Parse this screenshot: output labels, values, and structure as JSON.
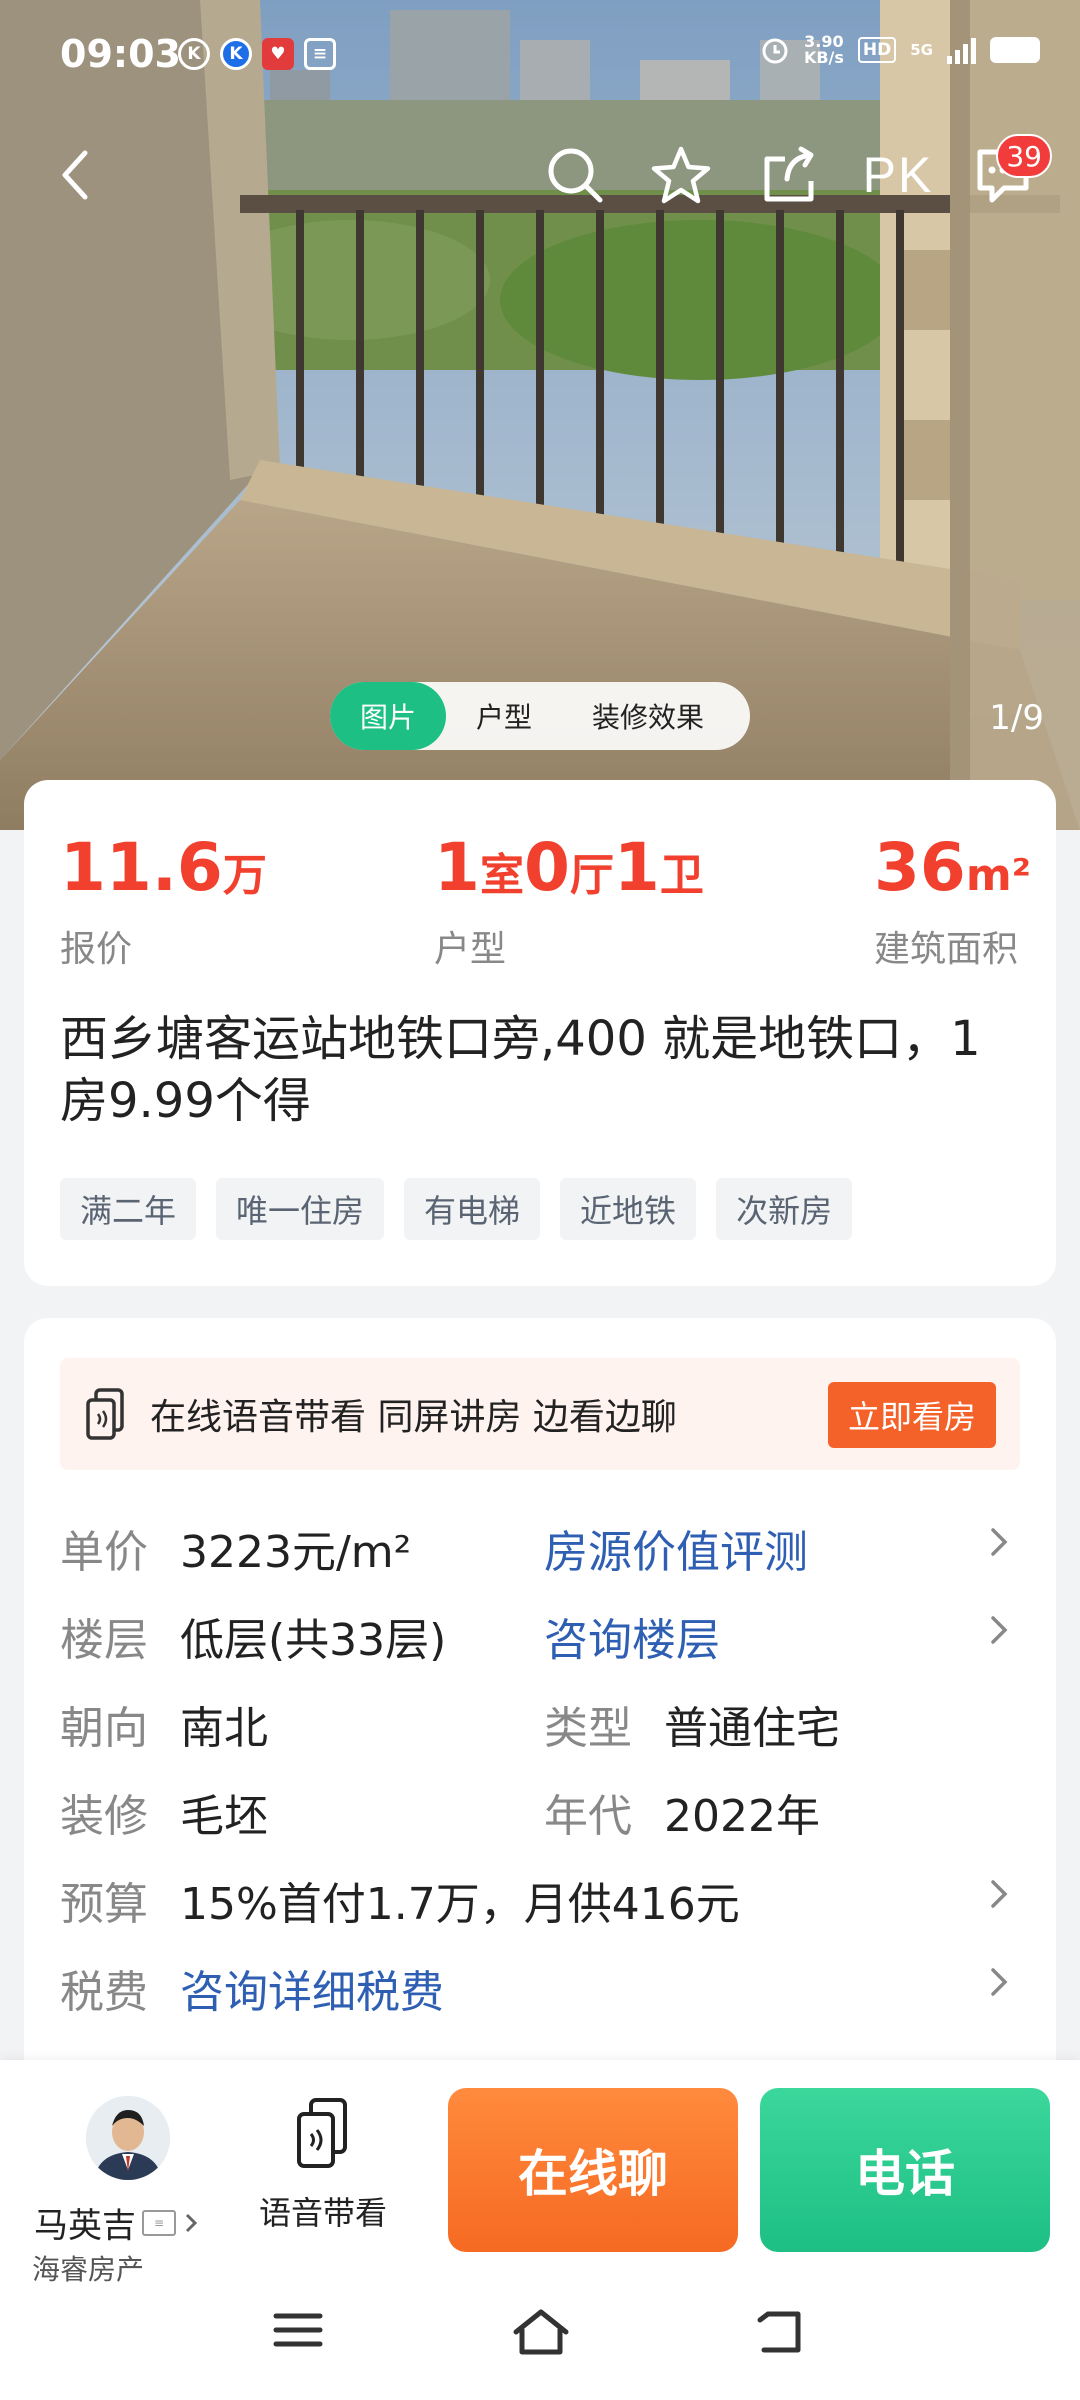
{
  "status_bar": {
    "time": "09:03",
    "net_speed_value": "3.90",
    "net_speed_unit": "KB/s",
    "hd_label": "HD",
    "network_label": "5G",
    "notification_icons": [
      "k-icon",
      "k-blue-icon",
      "heart-app-icon",
      "card-app-icon"
    ]
  },
  "top_nav": {
    "pk_label": "PK",
    "message_badge": "39"
  },
  "media": {
    "tabs": [
      "图片",
      "户型",
      "装修效果"
    ],
    "active_tab": 0,
    "counter": "1/9"
  },
  "summary": {
    "price_value": "11.6",
    "price_unit": "万",
    "price_label": "报价",
    "layout_n1": "1",
    "layout_u1": "室",
    "layout_n2": "0",
    "layout_u2": "厅",
    "layout_n3": "1",
    "layout_u3": "卫",
    "layout_label": "户型",
    "area_value": "36",
    "area_unit": "m²",
    "area_label": "建筑面积",
    "title": "西乡塘客运站地铁口旁,400 就是地铁口，1房9.99个得",
    "tags": [
      "满二年",
      "唯一住房",
      "有电梯",
      "近地铁",
      "次新房"
    ]
  },
  "banner": {
    "text": "在线语音带看  同屏讲房 边看边聊",
    "button": "立即看房"
  },
  "details": {
    "unit_price_key": "单价",
    "unit_price_value": "3223元/m²",
    "value_assess_link": "房源价值评测",
    "floor_key": "楼层",
    "floor_value": "低层(共33层)",
    "floor_consult_link": "咨询楼层",
    "orientation_key": "朝向",
    "orientation_value": "南北",
    "type_key": "类型",
    "type_value": "普通住宅",
    "decoration_key": "装修",
    "decoration_value": "毛坯",
    "year_key": "年代",
    "year_value": "2022年",
    "budget_key": "预算",
    "budget_value": "15%首付1.7万，月供416元",
    "tax_key": "税费",
    "tax_link": "咨询详细税费"
  },
  "bottom_bar": {
    "agent_name": "马英吉",
    "agent_company": "海睿房产",
    "voice_label": "语音带看",
    "chat_button": "在线聊",
    "call_button": "电话"
  },
  "colors": {
    "price_red": "#f2402f",
    "accent_green": "#1dbf85",
    "accent_orange": "#f66a22",
    "link_blue": "#2f5fb3"
  }
}
